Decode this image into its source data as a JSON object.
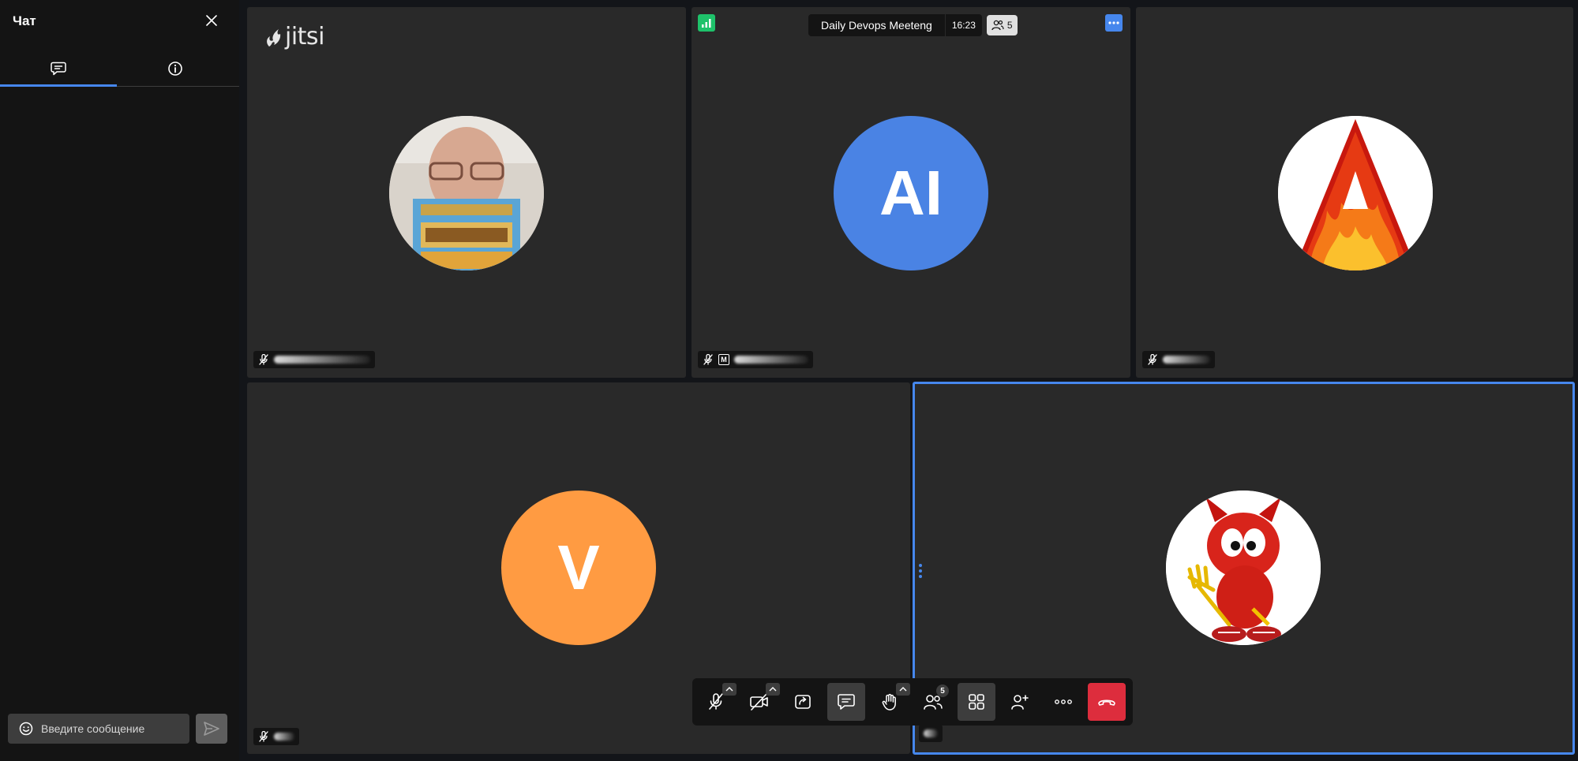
{
  "chat": {
    "title": "Чат",
    "tabs": [
      {
        "name": "messages",
        "icon": "chat-bubble-icon",
        "active": true
      },
      {
        "name": "info",
        "icon": "info-icon",
        "active": false
      }
    ],
    "input_placeholder": "Введите сообщение"
  },
  "meeting": {
    "title": "Daily Devops Meeteng",
    "timer": "16:23",
    "participant_count": "5",
    "brand": "jitsi"
  },
  "participants": [
    {
      "avatar": "photo",
      "initials": "",
      "muted": true,
      "moderator": false
    },
    {
      "avatar": "initials",
      "initials": "AI",
      "color": "#4a83e4",
      "muted": true,
      "moderator": true
    },
    {
      "avatar": "flame-letter-image",
      "initials": "",
      "muted": true,
      "moderator": false
    },
    {
      "avatar": "initials",
      "initials": "V",
      "color": "#ff9b42",
      "muted": true,
      "moderator": false
    },
    {
      "avatar": "devil-mascot-image",
      "initials": "",
      "muted": false,
      "moderator": false,
      "active": true
    }
  ],
  "toolbar": {
    "participants_badge": "5",
    "buttons": [
      "mic-off-icon",
      "camera-off-icon",
      "share-screen-icon",
      "chat-icon",
      "raise-hand-icon",
      "participants-icon",
      "tile-view-icon",
      "invite-icon",
      "more-icon",
      "hangup-icon"
    ]
  },
  "colors": {
    "accent": "#4687ed",
    "hangup": "#dd2d3d",
    "tile_bg": "#292929",
    "panel_bg": "#141414",
    "signal": "#1ec26a"
  }
}
